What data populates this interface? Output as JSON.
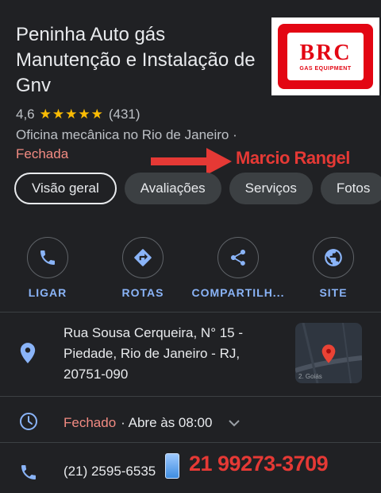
{
  "business": {
    "name": "Peninha Auto gás Manutenção e Instalação de Gnv",
    "rating": "4,6",
    "stars": "★★★★★",
    "review_count": "(431)",
    "category": "Oficina mecânica no Rio de Janeiro ·",
    "status": "Fechada"
  },
  "logo": {
    "mark": "BRC",
    "sub": "GAS EQUIPMENT"
  },
  "annotation": {
    "name": "Marcio Rangel",
    "phone": "21 99273-3709"
  },
  "tabs": [
    {
      "label": "Visão geral",
      "active": true
    },
    {
      "label": "Avaliações"
    },
    {
      "label": "Serviços"
    },
    {
      "label": "Fotos"
    }
  ],
  "actions": [
    {
      "label": "LIGAR",
      "icon": "phone-icon"
    },
    {
      "label": "ROTAS",
      "icon": "directions-icon"
    },
    {
      "label": "COMPARTILH...",
      "icon": "share-icon"
    },
    {
      "label": "SITE",
      "icon": "globe-icon"
    }
  ],
  "address": {
    "line1": "Rua Sousa Cerqueira, N° 15 -",
    "line2": "Piedade, Rio de Janeiro - RJ,",
    "line3": "20751-090",
    "map_street": "2. Goiás"
  },
  "hours": {
    "closed": "Fechado",
    "opens": "· Abre às 08:00"
  },
  "phone": {
    "number": "(21) 2595-6535"
  },
  "colors": {
    "background": "#202124",
    "accent": "#8ab4f8",
    "closed": "#f28b82",
    "stars": "#fbbc04",
    "annotation": "#e53935"
  }
}
